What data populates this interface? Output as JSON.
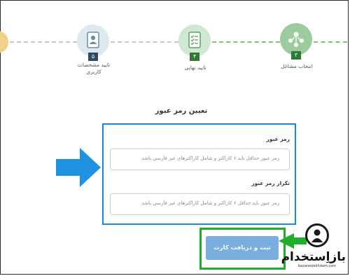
{
  "colors": {
    "highlight_blue": "#1c86d8",
    "highlight_green": "#1fae2c",
    "button_bg": "#79aede",
    "step_active": "#2e7a35"
  },
  "stepper": {
    "steps": [
      {
        "label": "انتخاب مشاغل",
        "number": "۳",
        "icon": "people-network-icon"
      },
      {
        "label": "تایید نهایی",
        "number": "۴",
        "icon": "checklist-document-icon"
      },
      {
        "label": "تایید مشخصات کاربری",
        "number": "۵",
        "icon": "user-profile-document-icon"
      }
    ]
  },
  "form": {
    "title": "تعیین رمز عبور",
    "password_label": "رمز عبور",
    "password_placeholder": "رمز عبور حداقل باید ۶ کاراکتر و شامل کاراکترهای غیر فارسی باشد",
    "confirm_label": "تکرار رمز عبور",
    "confirm_placeholder": "رمز عبور باید حداقل ۶ کاراکتر و شامل کاراکترهای غیر فارسی باشد",
    "submit_label": "ثبت و دریافت کارت"
  },
  "watermark": {
    "text": "بازاِستخدام",
    "subtext": "bazarestekhdam.com"
  }
}
